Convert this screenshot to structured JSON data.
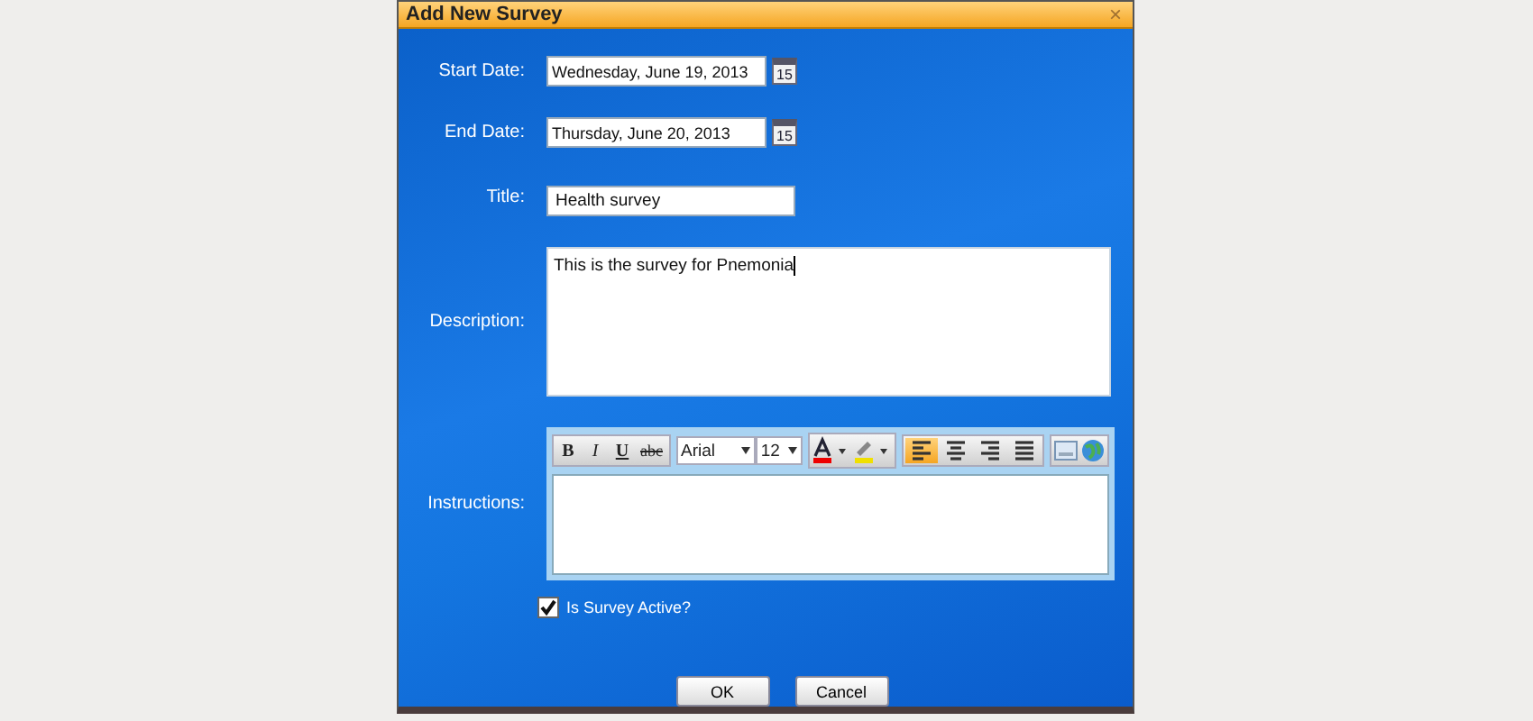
{
  "window": {
    "title": "Add New Survey",
    "close": "×"
  },
  "fields": [
    {
      "kind": "date",
      "label": "Start Date:",
      "value": "Wednesday, June 19, 2013",
      "calendar_day": "15"
    },
    {
      "kind": "date",
      "label": "End Date:",
      "value": "Thursday, June 20, 2013",
      "calendar_day": "15"
    },
    {
      "kind": "text",
      "label": "Title:",
      "value": "Health survey"
    },
    {
      "kind": "textarea",
      "label": "Description:",
      "value": "This is the survey for Pnemonia"
    },
    {
      "kind": "editor",
      "label": "Instructions:"
    }
  ],
  "editor_toolbar": {
    "format_buttons": [
      {
        "label": "B",
        "kind": "bold"
      },
      {
        "label": "I",
        "kind": "italic"
      },
      {
        "label": "U",
        "kind": "underline"
      },
      {
        "label": "abc",
        "kind": "strike"
      }
    ],
    "font": "Arial",
    "size": "12",
    "align_buttons": [
      {
        "kind": "left",
        "selected": true
      },
      {
        "kind": "center",
        "selected": false
      },
      {
        "kind": "right",
        "selected": false
      },
      {
        "kind": "justify",
        "selected": false
      }
    ]
  },
  "active_checkbox": {
    "label": "Is Survey Active?",
    "checked": true
  },
  "buttons": [
    "OK",
    "Cancel"
  ]
}
